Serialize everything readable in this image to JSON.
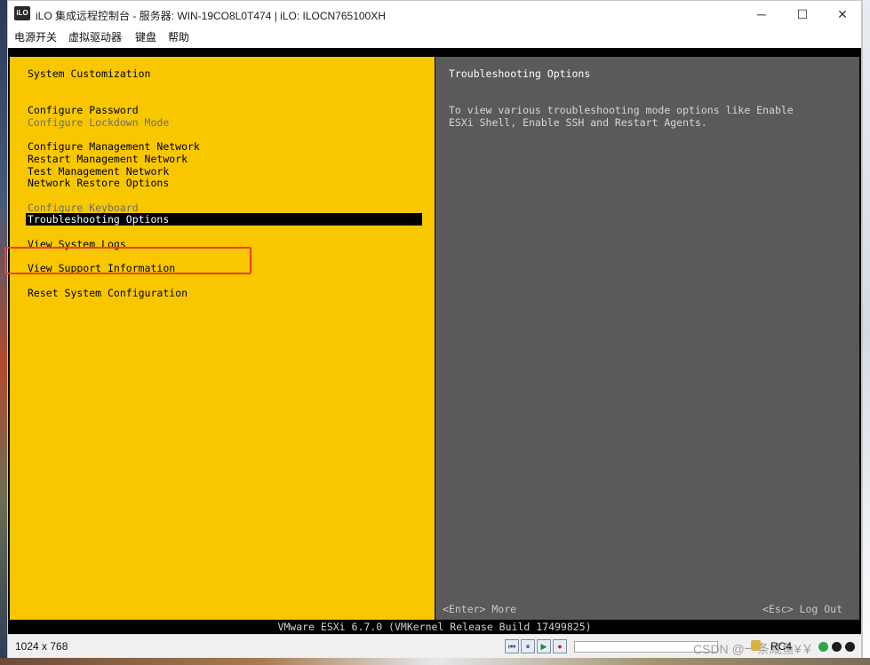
{
  "window": {
    "app_icon_text": "iLO",
    "title": "iLO 集成远程控制台 - 服务器: WIN-19CO8L0T474 | iLO: ILOCN765100XH",
    "minimize_glyph": "─",
    "maximize_glyph": "☐",
    "close_glyph": "✕"
  },
  "menubar": {
    "power": "电源开关",
    "virtual_drives": "虚拟驱动器",
    "keyboard": "键盘",
    "help": "帮助"
  },
  "console": {
    "left_title": "System Customization",
    "menu": {
      "configure_password": "Configure Password",
      "configure_lockdown": "Configure Lockdown Mode",
      "configure_mgmt_network": "Configure Management Network",
      "restart_mgmt_network": "Restart Management Network",
      "test_mgmt_network": "Test Management Network",
      "network_restore": "Network Restore Options",
      "configure_keyboard": "Configure Keyboard",
      "troubleshooting": "Troubleshooting Options",
      "view_logs": "View System Logs",
      "view_support": "View Support Information",
      "reset_config": "Reset System Configuration"
    },
    "right_title": "Troubleshooting Options",
    "right_description": "To view various troubleshooting mode options like Enable\nESXi Shell, Enable SSH and Restart Agents.",
    "hint_enter": "<Enter> More",
    "hint_esc": "<Esc> Log Out",
    "version": "VMware ESXi 6.7.0 (VMKernel Release Build 17499825)"
  },
  "statusbar": {
    "resolution": "1024 x 768",
    "rewind_glyph": "⏮",
    "pause_glyph": "⏸",
    "play_glyph": "▶",
    "record_glyph": "●",
    "watermark": "CSDN @一条咸鱼¥￥",
    "encryption": "RC4"
  },
  "colors": {
    "dcui_yellow": "#f8c700",
    "dcui_gray": "#5a5a5a",
    "highlight_red": "#f03c2e"
  },
  "icons": [
    "ilo-logo-icon",
    "lock-icon",
    "rewind-icon",
    "pause-icon",
    "play-icon",
    "record-icon"
  ]
}
